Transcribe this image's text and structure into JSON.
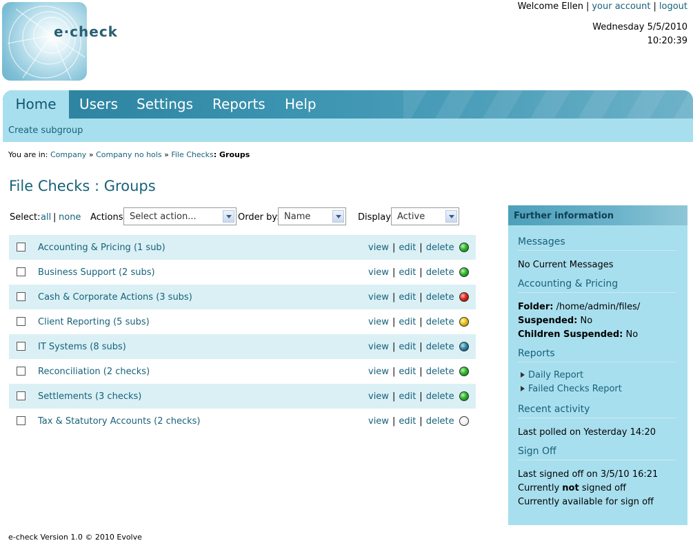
{
  "header": {
    "logo_text": "e·check",
    "welcome": "Welcome Ellen",
    "account_link": "your account",
    "logout_link": "logout",
    "date": "Wednesday 5/5/2010",
    "time": "10:20:39"
  },
  "nav": {
    "tabs": [
      {
        "label": "Home",
        "active": true
      },
      {
        "label": "Users"
      },
      {
        "label": "Settings"
      },
      {
        "label": "Reports"
      },
      {
        "label": "Help"
      }
    ],
    "sub_link": "Create subgroup"
  },
  "breadcrumb": {
    "prefix": "You are in:",
    "items": [
      "Company",
      "Company no hols",
      "File Checks"
    ],
    "sep": "»",
    "current": ": Groups"
  },
  "page_title": "File Checks : Groups",
  "filters": {
    "select_label": "Select:",
    "all": "all",
    "none": "none",
    "actions_label": "Actions:",
    "actions_value": "Select action...",
    "order_label": "Order by:",
    "order_value": "Name",
    "display_label": "Display:",
    "display_value": "Active"
  },
  "row_actions": {
    "view": "view",
    "edit": "edit",
    "delete": "delete"
  },
  "groups": [
    {
      "name": "Accounting & Pricing (1 sub)",
      "status": "green"
    },
    {
      "name": "Business Support (2 subs)",
      "status": "green"
    },
    {
      "name": "Cash & Corporate Actions (3 subs)",
      "status": "red"
    },
    {
      "name": "Client Reporting (5 subs)",
      "status": "yellow"
    },
    {
      "name": "IT Systems (8 subs)",
      "status": "blue"
    },
    {
      "name": "Reconciliation (2 checks)",
      "status": "green"
    },
    {
      "name": "Settlements (3 checks)",
      "status": "green"
    },
    {
      "name": "Tax & Statutory Accounts (2 checks)",
      "status": "white"
    }
  ],
  "panel": {
    "title": "Further information",
    "messages_heading": "Messages",
    "messages_text": "No Current Messages",
    "group_heading": "Accounting & Pricing",
    "folder_label": "Folder:",
    "folder_value": "/home/admin/files/",
    "suspended_label": "Suspended:",
    "suspended_value": "No",
    "children_label": "Children Suspended:",
    "children_value": "No",
    "reports_heading": "Reports",
    "report_links": [
      "Daily Report",
      "Failed Checks Report"
    ],
    "activity_heading": "Recent activity",
    "activity_text": "Last polled on Yesterday 14:20",
    "signoff_heading": "Sign Off",
    "signoff_line1": "Last signed off on 3/5/10 16:21",
    "signoff_line2_pre": "Currently",
    "signoff_line2_bold": "not",
    "signoff_line2_post": "signed off",
    "signoff_line3": "Currently available for sign off"
  },
  "footer": "e-check Version 1.0 © 2010 Evolve",
  "colors": {
    "accent": "#17617a",
    "nav": "#3a93b0",
    "panel": "#a8dfee",
    "row_alt": "#daf0f5"
  }
}
